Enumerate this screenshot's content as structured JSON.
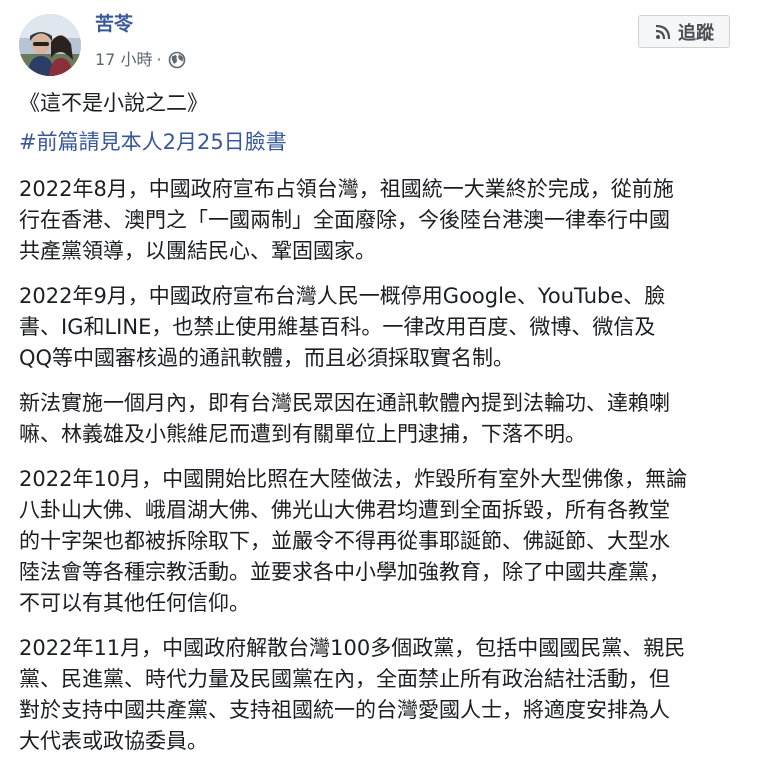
{
  "post": {
    "author": "苦苓",
    "time": "17 小時",
    "separator": "·",
    "follow_label": "追蹤",
    "title": "《這不是小說之二》",
    "hashtag": "#前篇請見本人2月25日臉書",
    "paragraphs": [
      {
        "lines": [
          "2022年8月，中國政府宣布占領台灣，祖國統一大業終於完成，從前施",
          "行在香港、澳門之「一國兩制」全面廢除，今後陸台港澳一律奉行中國",
          "共產黨領導，以團結民心、鞏固國家。"
        ]
      },
      {
        "lines": [
          "2022年9月，中國政府宣布台灣人民一概停用Google、YouTube、臉",
          "書、IG和LINE，也禁止使用維基百科。一律改用百度、微博、微信及",
          "QQ等中國審核過的通訊軟體，而且必須採取實名制。"
        ]
      },
      {
        "lines": [
          "新法實施一個月內，即有台灣民眾因在通訊軟體內提到法輪功、達賴喇",
          "嘛、林義雄及小熊維尼而遭到有關單位上門逮捕，下落不明。"
        ]
      },
      {
        "lines": [
          "2022年10月，中國開始比照在大陸做法，炸毀所有室外大型佛像，無論",
          "八卦山大佛、峨眉湖大佛、佛光山大佛君均遭到全面拆毀，所有各教堂",
          "的十字架也都被拆除取下，並嚴令不得再從事耶誕節、佛誕節、大型水",
          "陸法會等各種宗教活動。並要求各中小學加強教育，除了中國共產黨，",
          "不可以有其他任何信仰。"
        ]
      },
      {
        "lines": [
          "2022年11月，中國政府解散台灣100多個政黨，包括中國國民黨、親民",
          "黨、民進黨、時代力量及民國黨在內，全面禁止所有政治結社活動，但",
          "對於支持中國共產黨、支持祖國統一的台灣愛國人士，將適度安排為人",
          "大代表或政協委員。"
        ]
      }
    ]
  },
  "icons": {
    "privacy": "globe-icon",
    "follow": "rss-icon",
    "avatar": "avatar-photo"
  },
  "colors": {
    "link": "#385898",
    "meta": "#606770",
    "text": "#1c1e21",
    "button_bg": "#f5f6f7",
    "button_border": "#ced0d4"
  }
}
